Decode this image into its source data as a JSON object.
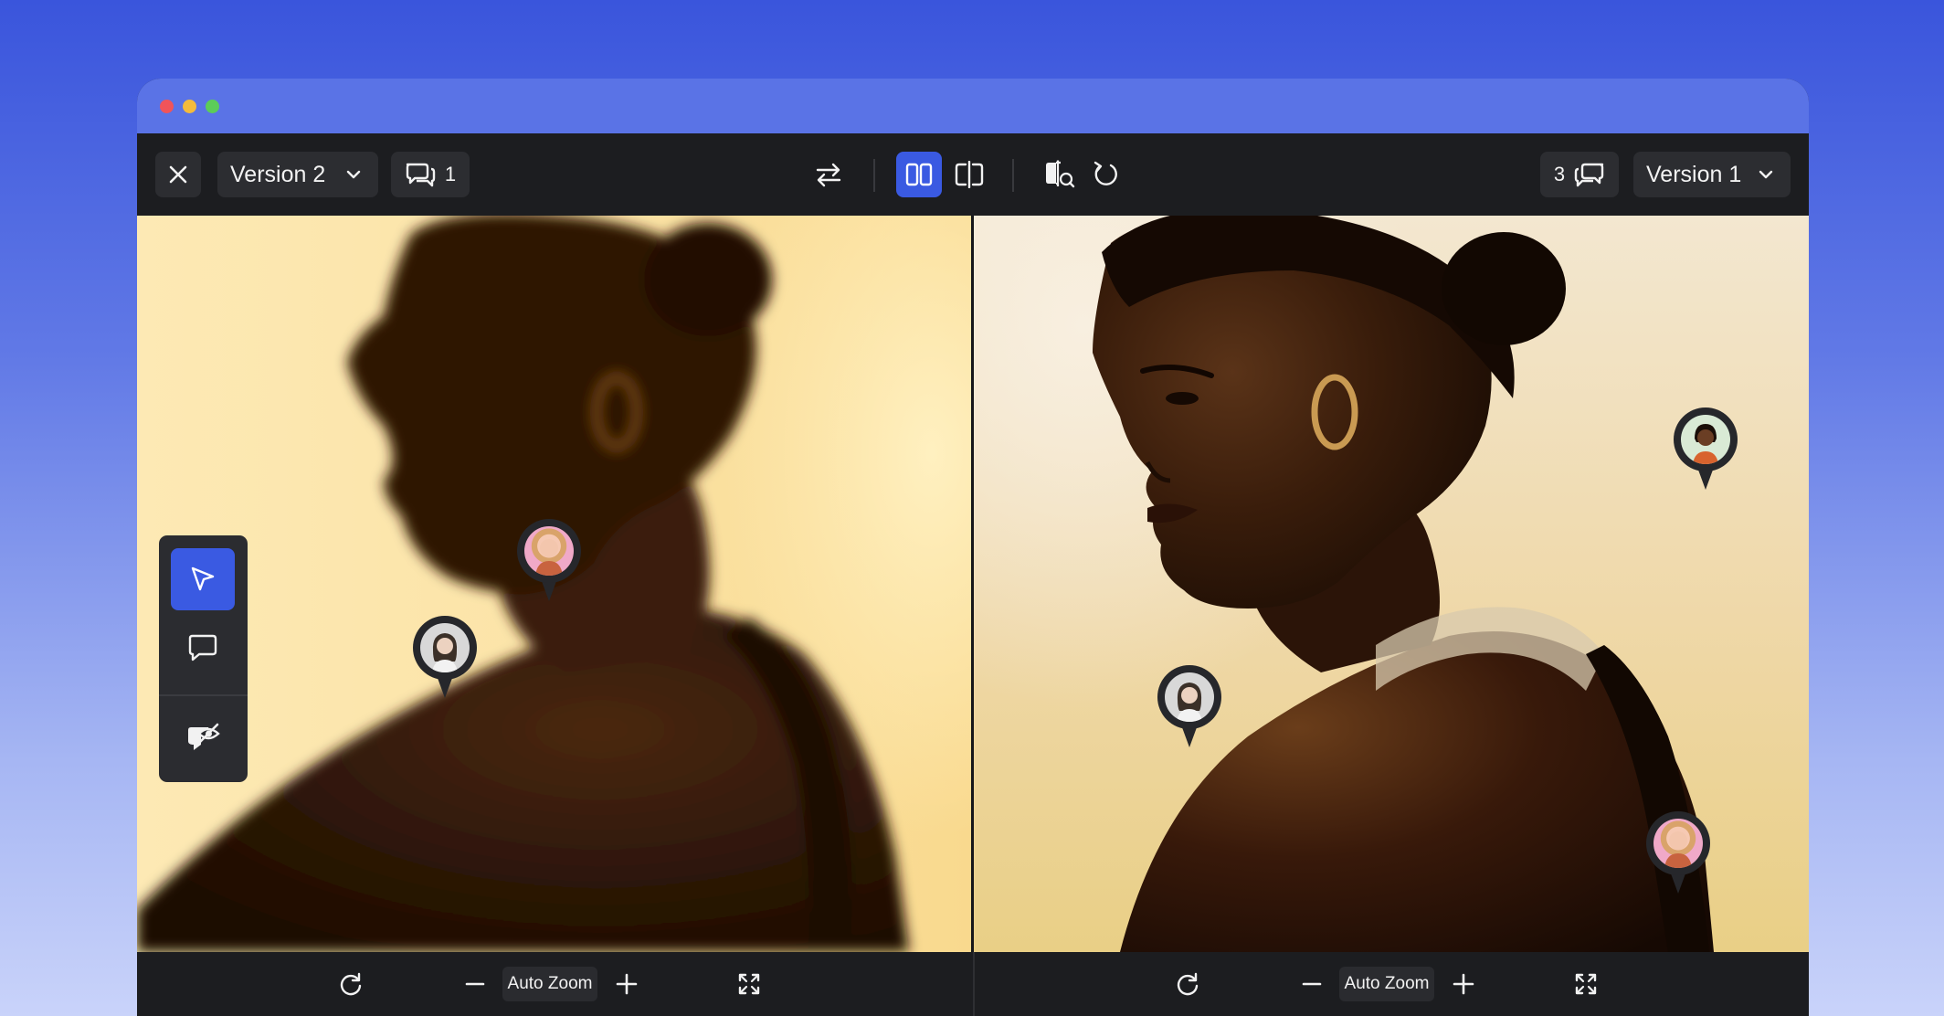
{
  "window": {
    "left_version": "Version 2",
    "left_comments": "1",
    "right_version": "Version 1",
    "right_comments": "3"
  },
  "icons": {
    "close": "close-icon",
    "chevron": "chevron-down-icon",
    "comments": "comments-icon",
    "swap": "swap-arrows-icon",
    "side_by_side": "side-by-side-icon",
    "split": "split-view-icon",
    "compare": "compare-overlay-icon",
    "reset": "rotate-icon",
    "pointer": "cursor-arrow-icon",
    "comment": "comment-bubble-icon",
    "hide_comments": "hide-comments-icon",
    "zoom_out": "minus-icon",
    "zoom_in": "plus-icon",
    "fullscreen": "fullscreen-icon"
  },
  "bottom": {
    "left_zoom": "Auto Zoom",
    "right_zoom": "Auto Zoom"
  },
  "colors": {
    "accent": "#3a5ae2",
    "toolbar": "#1c1d20",
    "button": "#2c2d31"
  }
}
